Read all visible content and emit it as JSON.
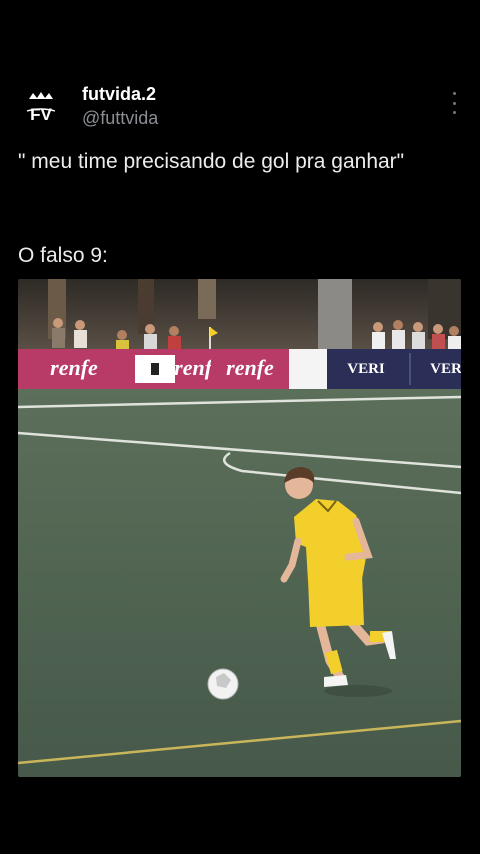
{
  "tweet": {
    "display_name": "futvida.2",
    "handle": "@futtvida",
    "logo_text": "FV",
    "caption_line1": "\" meu time precisando de gol pra ganhar\"",
    "caption_line2": "O falso 9:"
  },
  "media": {
    "type": "video-frame",
    "ad_boards": [
      "renfe",
      "renfe",
      "renfe",
      "VERI",
      "VER"
    ],
    "colors": {
      "pitch": "#4f6350",
      "jersey": "#f2cf2a",
      "board": "#b83a67",
      "board_dark": "#2b2f57"
    }
  },
  "icons": {
    "more": "more-vertical-icon"
  }
}
